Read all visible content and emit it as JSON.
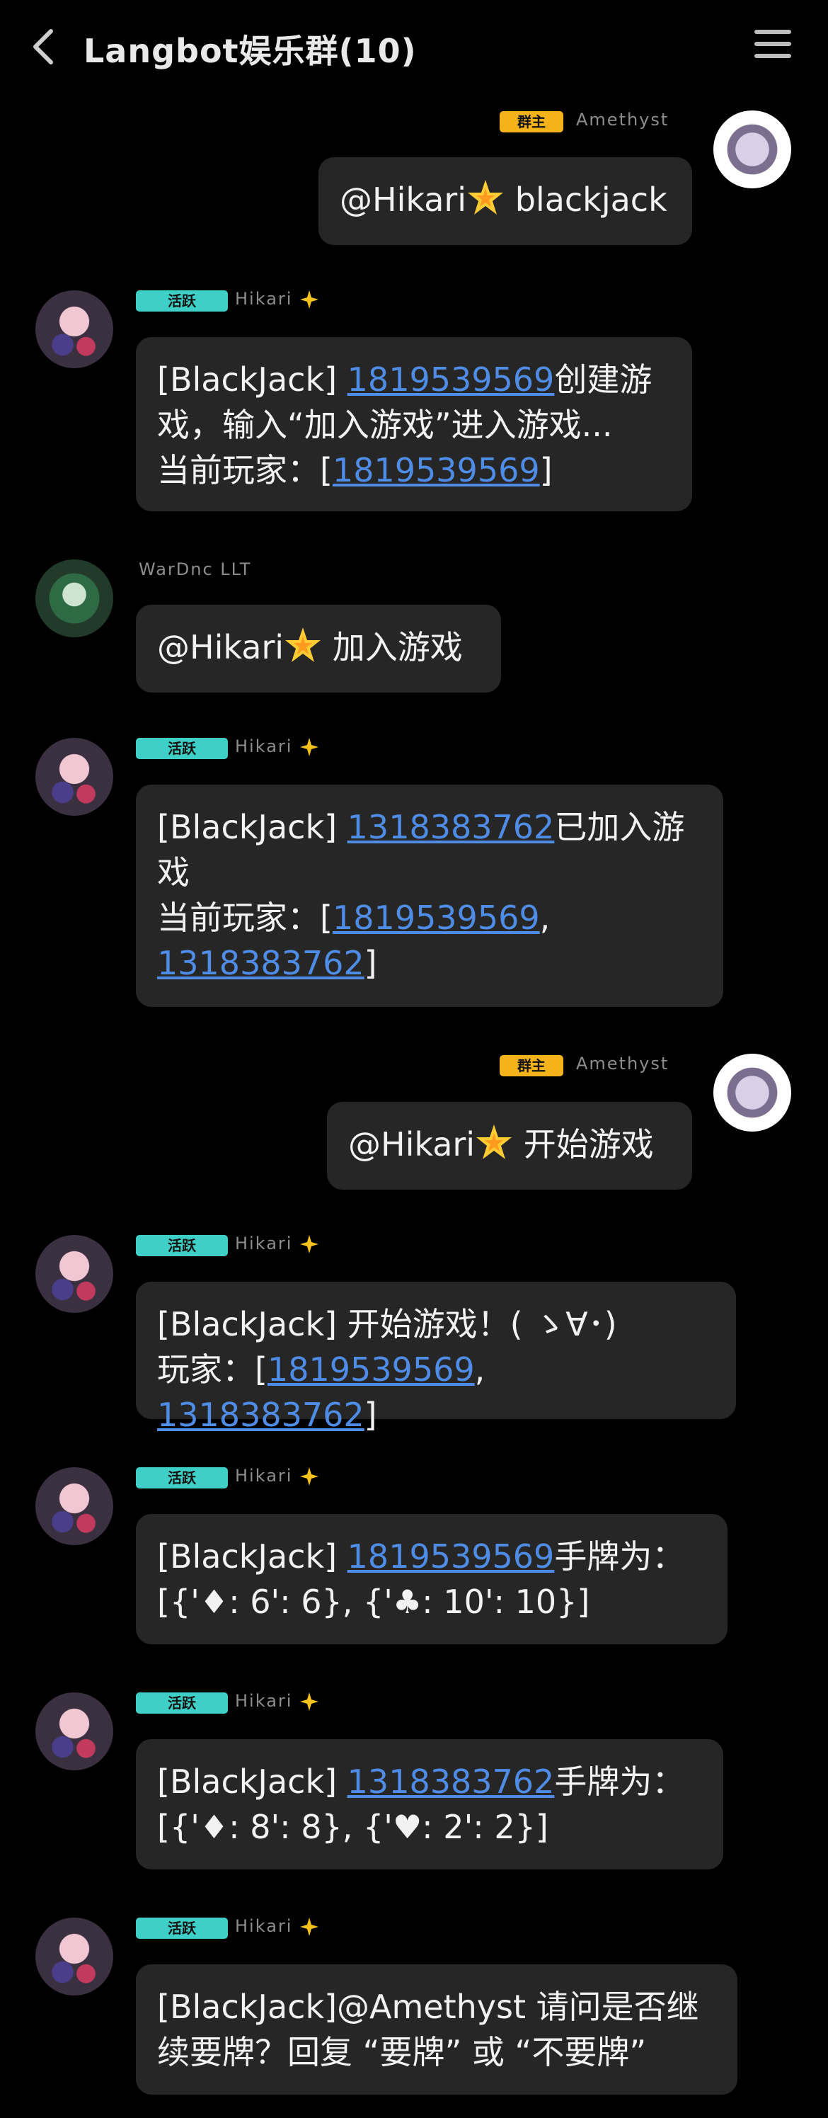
{
  "header": {
    "title": "Langbot娱乐群(10)"
  },
  "badges": {
    "bot": "活跃",
    "me": "群主"
  },
  "nicknames": {
    "bot": "Hikari",
    "me": "Amethyst",
    "other": "WarDnc LLT"
  },
  "messages": [
    {
      "line1": "@Hikari",
      "line1b": " blackjack"
    },
    {
      "p1": "[BlackJack] ",
      "id1": "1819539569",
      "p2": "创建游",
      "line2": "戏，输入“加入游戏”进入游戏...",
      "line3a": "当前玩家：[",
      "id2": "1819539569",
      "line3b": "]"
    },
    {
      "line1": "@Hikari",
      "line1b": " 加入游戏"
    },
    {
      "p1": "[BlackJack] ",
      "id1": "1318383762",
      "p2": "已加入游",
      "line2": "戏",
      "line3a": "当前玩家：[",
      "id2": "1819539569",
      "line3b": ",",
      "id3": "1318383762",
      "line4b": "]"
    },
    {
      "line1": "@Hikari",
      "line1b": " 开始游戏"
    },
    {
      "line1": "[BlackJack] 开始游戏！( ゝ∀･)",
      "line2a": "玩家：[",
      "id1": "1819539569",
      "sep": ", ",
      "id2": "1318383762",
      "line2b": "]"
    },
    {
      "p1": "[BlackJack] ",
      "id1": "1819539569",
      "p2": "手牌为：",
      "line2": "[{'♦: 6': 6}, {'♣: 10': 10}]"
    },
    {
      "p1": "[BlackJack] ",
      "id1": "1318383762",
      "p2": "手牌为：",
      "line2": "[{'♦: 8': 8}, {'♥: 2': 2}]"
    },
    {
      "line1": "[BlackJack]@Amethyst 请问是否继",
      "line2": "续要牌？回复 “要牌” 或 “不要牌”"
    }
  ]
}
